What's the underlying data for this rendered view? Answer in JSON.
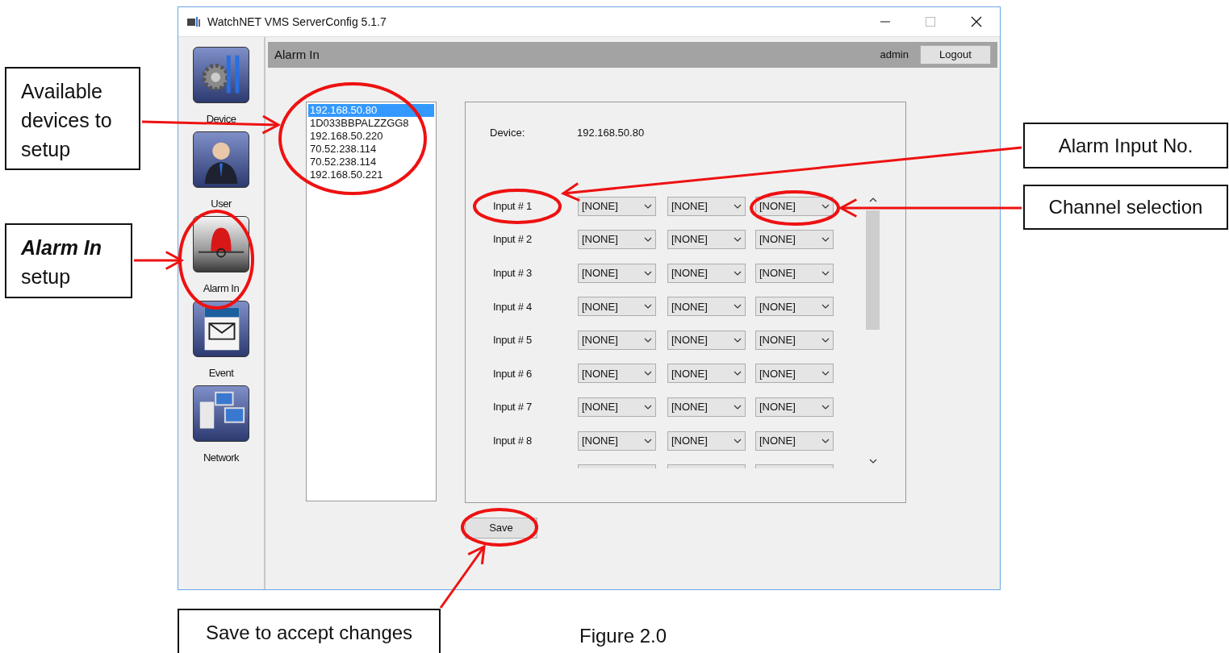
{
  "window": {
    "title": "WatchNET VMS ServerConfig 5.1.7"
  },
  "sidebar": {
    "items": [
      {
        "label": "Device",
        "kind": "device"
      },
      {
        "label": "User",
        "kind": "user"
      },
      {
        "label": "Alarm In",
        "kind": "alarm"
      },
      {
        "label": "Event",
        "kind": "event"
      },
      {
        "label": "Network",
        "kind": "network"
      }
    ]
  },
  "header": {
    "title": "Alarm In",
    "user": "admin",
    "logout": "Logout"
  },
  "devices": [
    {
      "label": "192.168.50.80",
      "selected": true
    },
    {
      "label": "1D033BBPALZZGG8",
      "selected": false
    },
    {
      "label": "192.168.50.220",
      "selected": false
    },
    {
      "label": "70.52.238.114",
      "selected": false
    },
    {
      "label": "70.52.238.114",
      "selected": false
    },
    {
      "label": "192.168.50.221",
      "selected": false
    }
  ],
  "device_field": {
    "label": "Device:",
    "value": "192.168.50.80"
  },
  "inputs": [
    {
      "label": "Input # 1",
      "channels": [
        "[NONE]",
        "[NONE]",
        "[NONE]"
      ]
    },
    {
      "label": "Input # 2",
      "channels": [
        "[NONE]",
        "[NONE]",
        "[NONE]"
      ]
    },
    {
      "label": "Input # 3",
      "channels": [
        "[NONE]",
        "[NONE]",
        "[NONE]"
      ]
    },
    {
      "label": "Input # 4",
      "channels": [
        "[NONE]",
        "[NONE]",
        "[NONE]"
      ]
    },
    {
      "label": "Input # 5",
      "channels": [
        "[NONE]",
        "[NONE]",
        "[NONE]"
      ]
    },
    {
      "label": "Input # 6",
      "channels": [
        "[NONE]",
        "[NONE]",
        "[NONE]"
      ]
    },
    {
      "label": "Input # 7",
      "channels": [
        "[NONE]",
        "[NONE]",
        "[NONE]"
      ]
    },
    {
      "label": "Input # 8",
      "channels": [
        "[NONE]",
        "[NONE]",
        "[NONE]"
      ]
    }
  ],
  "save_button": "Save",
  "callouts": [
    {
      "text": "Available devices to setup"
    },
    {
      "emphasis": "Alarm In",
      "text": "setup"
    },
    {
      "text": "Alarm Input No."
    },
    {
      "text": "Channel selection"
    },
    {
      "text": "Save to accept changes"
    }
  ],
  "caption": "Figure 2.0"
}
